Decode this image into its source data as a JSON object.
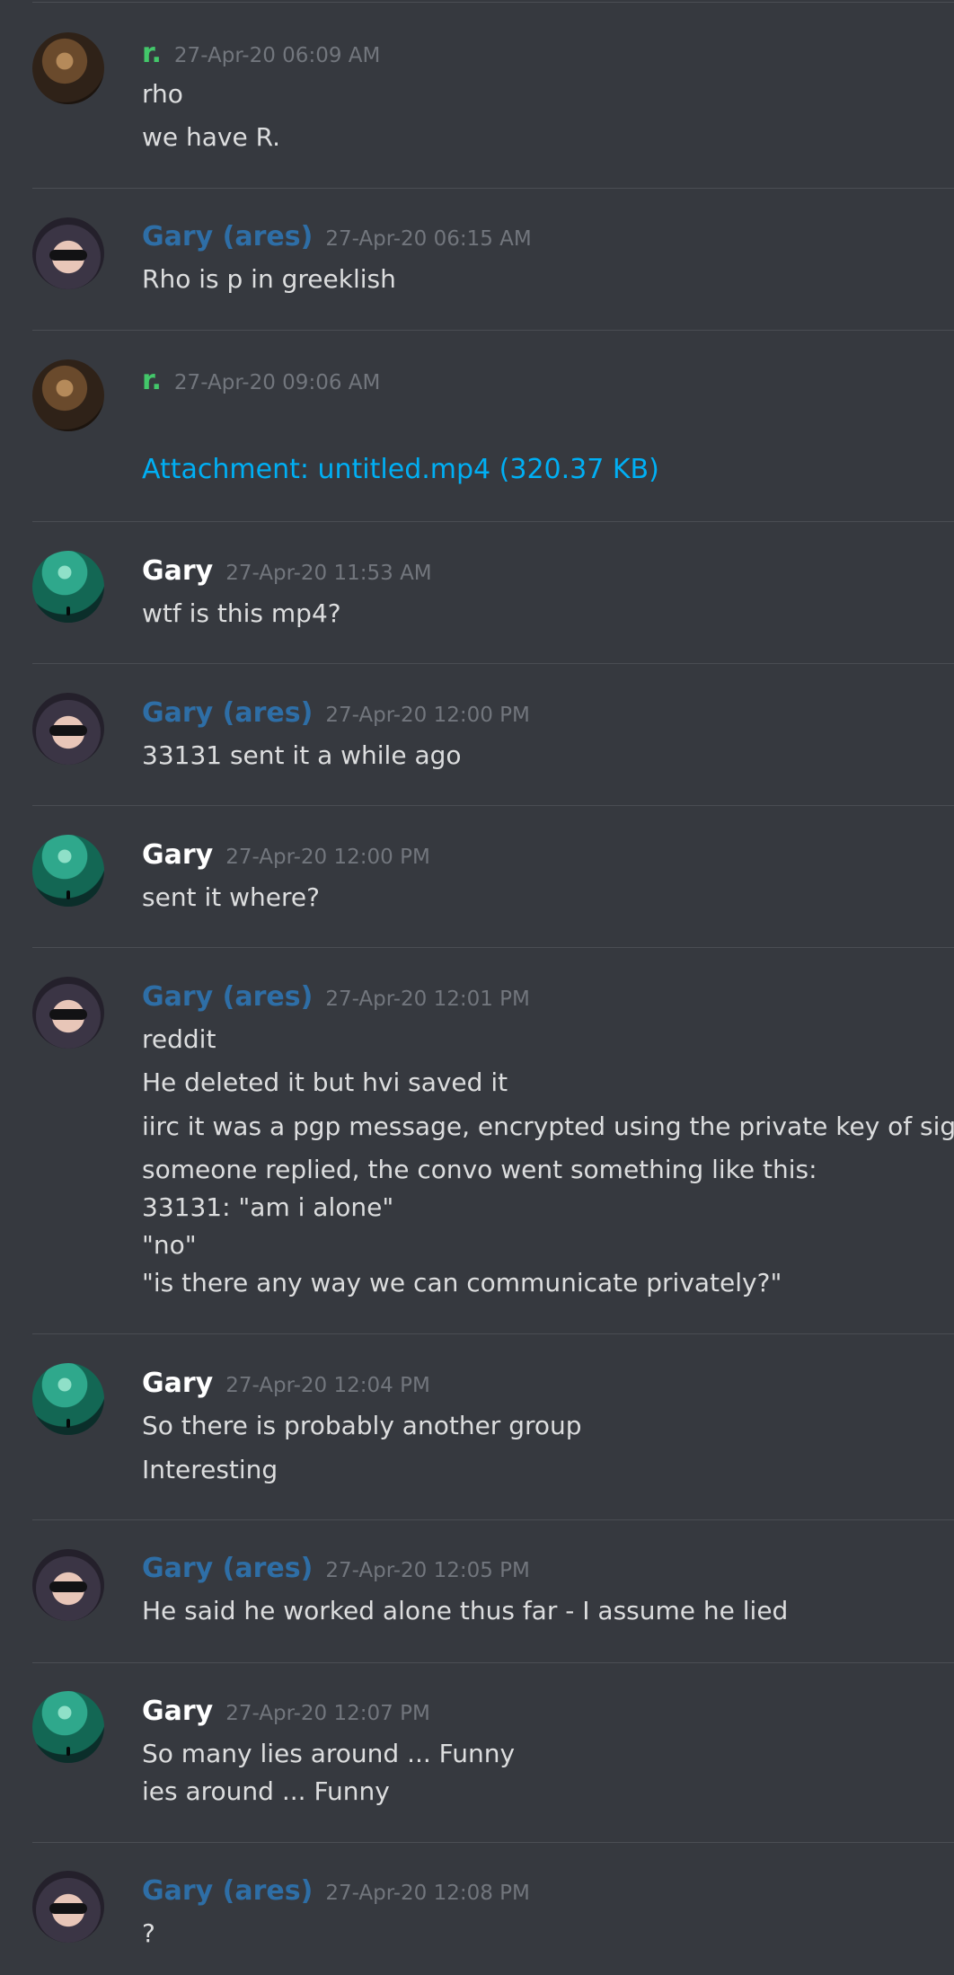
{
  "colors": {
    "background": "#36393f",
    "divider": "#4a4d53",
    "name_r": "#43c76a",
    "name_ares": "#2e6ea6",
    "name_gary": "#ffffff",
    "timestamp": "#72767d",
    "text": "#dcddde",
    "link": "#00aff4"
  },
  "messages": [
    {
      "author": "r.",
      "time": "27-Apr-20 06:09 AM",
      "lines": [
        "rho",
        "we have R."
      ]
    },
    {
      "author": "Gary (ares)",
      "time": "27-Apr-20 06:15 AM",
      "lines": [
        "Rho is p in greeklish"
      ]
    },
    {
      "author": "r.",
      "time": "27-Apr-20 09:06 AM",
      "attachment": "Attachment: untitled.mp4 (320.37 KB)"
    },
    {
      "author": "Gary",
      "time": "27-Apr-20 11:53 AM",
      "lines": [
        "wtf is this mp4?"
      ]
    },
    {
      "author": "Gary (ares)",
      "time": "27-Apr-20 12:00 PM",
      "lines": [
        "33131 sent it a while ago"
      ]
    },
    {
      "author": "Gary",
      "time": "27-Apr-20 12:00 PM",
      "lines": [
        "sent it where?"
      ]
    },
    {
      "author": "Gary (ares)",
      "time": "27-Apr-20 12:01 PM",
      "lines": [
        "reddit",
        "He deleted it but hvi saved it",
        "iirc it was a pgp message, encrypted using the private key of sigma",
        "someone replied, the convo went something like this:",
        "33131: \"am i alone\"",
        "\"no\"",
        "\"is there any way we can communicate privately?\""
      ]
    },
    {
      "author": "Gary",
      "time": "27-Apr-20 12:04 PM",
      "lines": [
        "So there is probably another group",
        "Interesting"
      ]
    },
    {
      "author": "Gary (ares)",
      "time": "27-Apr-20 12:05 PM",
      "lines": [
        "He said he worked alone thus far - I assume he lied"
      ]
    },
    {
      "author": "Gary",
      "time": "27-Apr-20 12:07 PM",
      "lines": [
        "So many lies around ... Funny",
        "ies around ... Funny"
      ]
    },
    {
      "author": "Gary (ares)",
      "time": "27-Apr-20 12:08 PM",
      "lines": [
        "?"
      ]
    }
  ]
}
